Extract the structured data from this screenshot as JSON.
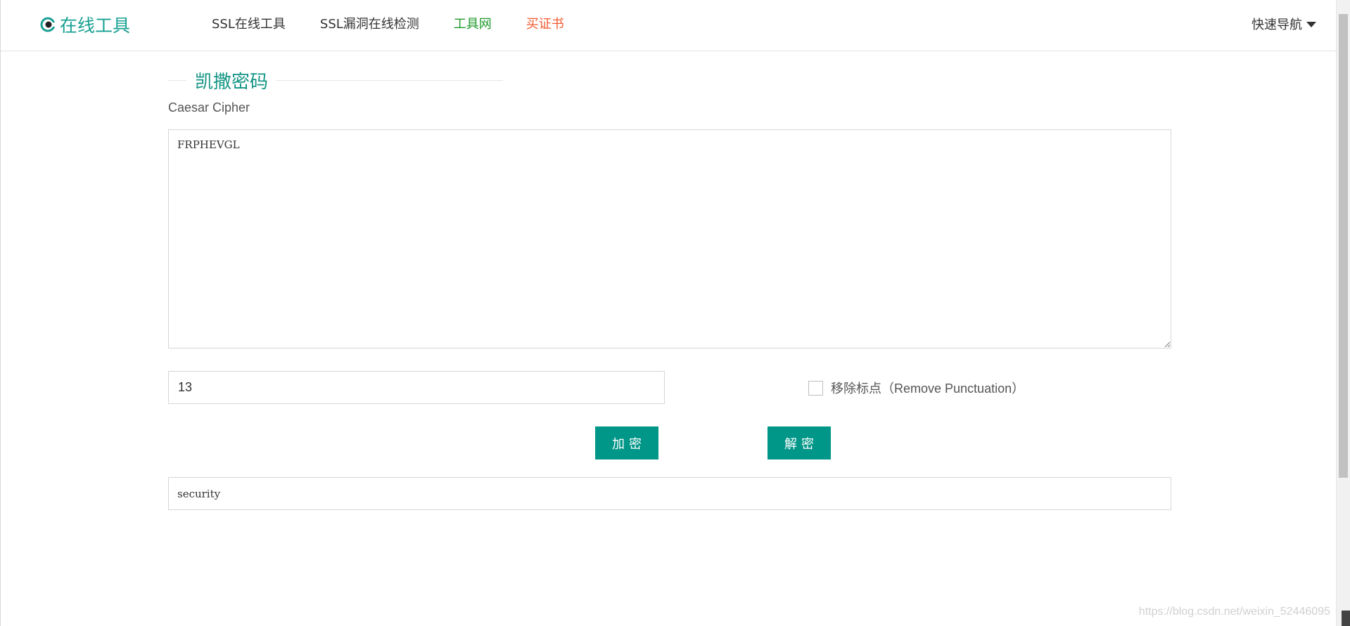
{
  "header": {
    "logo_text": "在线工具",
    "nav": [
      {
        "label": "SSL在线工具",
        "color": "#333333"
      },
      {
        "label": "SSL漏洞在线检测",
        "color": "#333333"
      },
      {
        "label": "工具网",
        "color": "#1e9a2b"
      },
      {
        "label": "买证书",
        "color": "#f0592c"
      }
    ],
    "quick_nav_label": "快速导航"
  },
  "tool": {
    "title": "凯撒密码",
    "subtitle": "Caesar Cipher",
    "input_text": "FRPHEVGL",
    "shift_value": "13",
    "remove_punctuation_label": "移除标点（Remove Punctuation）",
    "remove_punctuation_checked": false,
    "encrypt_label": "加密",
    "decrypt_label": "解密",
    "result_text": "security"
  },
  "watermark": "https://blog.csdn.net/weixin_52446095",
  "colors": {
    "brand": "#17a092",
    "button": "#009688",
    "title": "#139585"
  }
}
